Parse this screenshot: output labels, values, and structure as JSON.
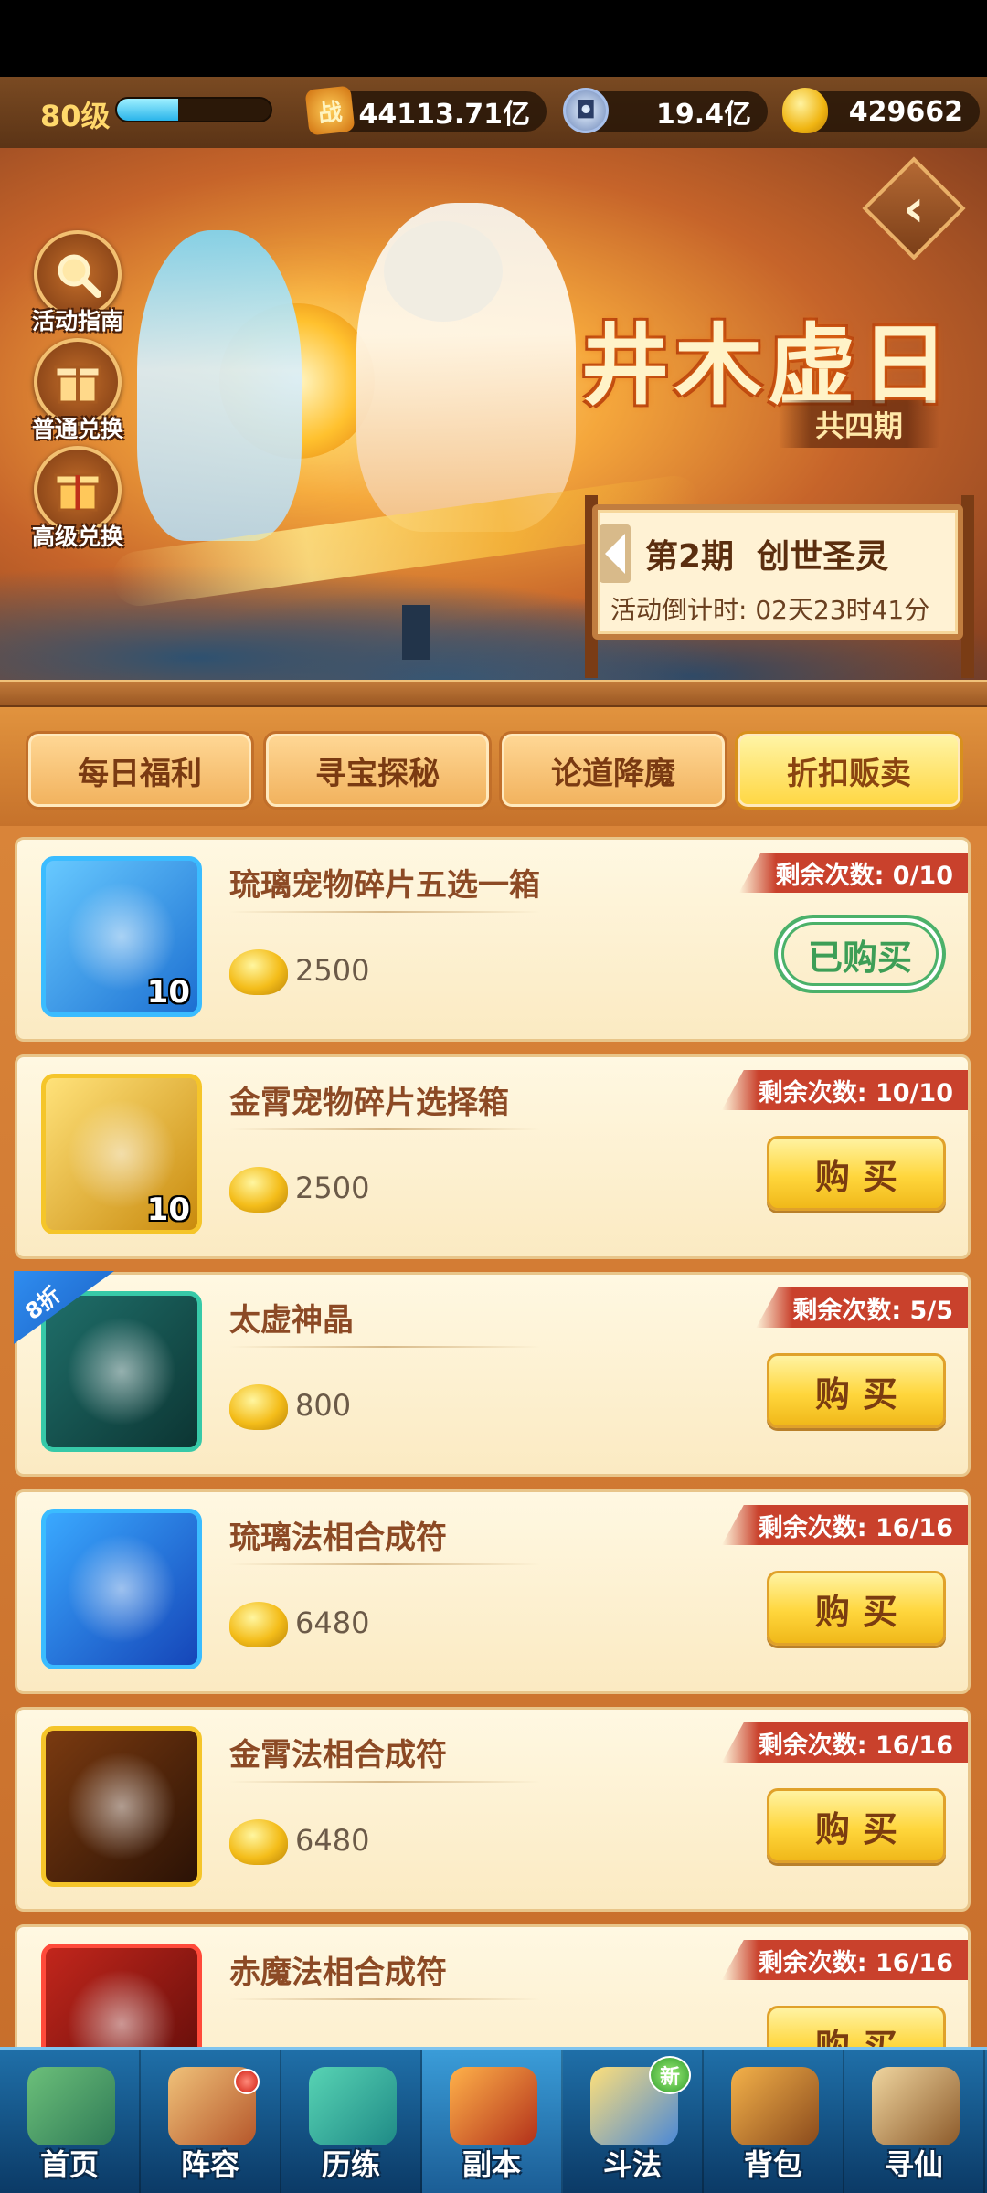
{
  "resources": {
    "level": "80级",
    "xp_fraction": 0.4,
    "power_icon_text": "战",
    "power": "44113.71亿",
    "coin": "19.4亿",
    "gold": "429662"
  },
  "side_buttons": [
    {
      "label": "活动指南",
      "icon": "magnifier-icon"
    },
    {
      "label": "普通兑换",
      "icon": "gift-box-icon"
    },
    {
      "label": "高级兑换",
      "icon": "gift-box-icon"
    }
  ],
  "event": {
    "title": "井木虚日",
    "subtitle": "共四期",
    "period_title": "第2期  创世圣灵",
    "countdown": "活动倒计时: 02天23时41分"
  },
  "tabs": [
    {
      "label": "每日福利",
      "active": false
    },
    {
      "label": "寻宝探秘",
      "active": false
    },
    {
      "label": "论道降魔",
      "active": false
    },
    {
      "label": "折扣贩卖",
      "active": true
    }
  ],
  "items": [
    {
      "name": "琉璃宠物碎片五选一箱",
      "price": "2500",
      "remaining": "剩余次数: 0/10",
      "count": "10",
      "button": "已购买",
      "bought": true,
      "border": "#3bbcff",
      "art": [
        "#67c9ff",
        "#1c6fd1"
      ]
    },
    {
      "name": "金霄宠物碎片选择箱",
      "price": "2500",
      "remaining": "剩余次数: 10/10",
      "count": "10",
      "button": "购买",
      "bought": false,
      "border": "#f5c52a",
      "art": [
        "#ffe27a",
        "#c98a0d"
      ]
    },
    {
      "name": "太虚神晶",
      "price": "800",
      "remaining": "剩余次数: 5/5",
      "count": "",
      "button": "购买",
      "bought": false,
      "discount": "8折",
      "border": "#37c9a8",
      "art": [
        "#1f6f6a",
        "#0c3533"
      ]
    },
    {
      "name": "琉璃法相合成符",
      "price": "6480",
      "remaining": "剩余次数: 16/16",
      "count": "",
      "button": "购买",
      "bought": false,
      "border": "#3bbcff",
      "art": [
        "#3aa9ff",
        "#1545b8"
      ]
    },
    {
      "name": "金霄法相合成符",
      "price": "6480",
      "remaining": "剩余次数: 16/16",
      "count": "",
      "button": "购买",
      "bought": false,
      "border": "#f5c52a",
      "art": [
        "#7a3a10",
        "#2b1205"
      ]
    },
    {
      "name": "赤魔法相合成符",
      "price": "",
      "remaining": "剩余次数: 16/16",
      "count": "",
      "button": "购买",
      "bought": false,
      "border": "#ff4a3a",
      "art": [
        "#c2261c",
        "#5a0b08"
      ]
    }
  ],
  "nav": [
    {
      "label": "首页",
      "active": false,
      "dot": false,
      "new": false,
      "art": [
        "#6cc07a",
        "#2f7a56"
      ]
    },
    {
      "label": "阵容",
      "active": false,
      "dot": true,
      "new": false,
      "art": [
        "#f0c27a",
        "#b5562a"
      ]
    },
    {
      "label": "历练",
      "active": false,
      "dot": false,
      "new": false,
      "art": [
        "#58d4b4",
        "#1f8a86"
      ]
    },
    {
      "label": "副本",
      "active": true,
      "dot": false,
      "new": false,
      "art": [
        "#ffb24a",
        "#b2301a"
      ]
    },
    {
      "label": "斗法",
      "active": false,
      "dot": false,
      "new": true,
      "new_label": "新",
      "art": [
        "#ffe07a",
        "#4a88d6"
      ]
    },
    {
      "label": "背包",
      "active": false,
      "dot": false,
      "new": false,
      "art": [
        "#f4b24a",
        "#8a4a1c"
      ]
    },
    {
      "label": "寻仙",
      "active": false,
      "dot": false,
      "new": false,
      "art": [
        "#f0d6a0",
        "#8c5a2a"
      ]
    }
  ]
}
